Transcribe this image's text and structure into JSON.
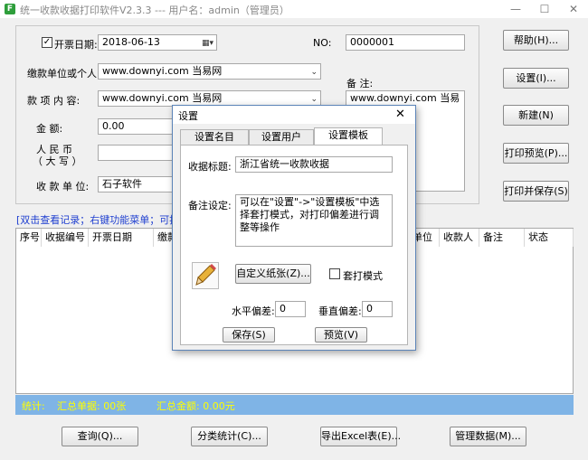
{
  "window": {
    "title": "统一收款收据打印软件V2.3.3 --- 用户名：admin（管理员）",
    "icon_letter": "F",
    "minimize": "—",
    "maximize": "☐",
    "close": "✕"
  },
  "form": {
    "invoice_date_checkbox": "✓",
    "invoice_date_label": "开票日期:",
    "invoice_date_value": "2018-06-13",
    "no_label": "NO:",
    "no_value": "0000001",
    "payer_label": "缴款单位或个人:",
    "payer_value": "www.downyi.com  当易网",
    "item_label": "款  项  内  容:",
    "item_value": "www.downyi.com  当易网",
    "amount_label": "金       额:",
    "amount_value": "0.00",
    "rmb_label_1": "人   民   币",
    "rmb_label_2": "（ 大  写 ）",
    "rmb_value": "",
    "receiver_label": "收  款  单  位:",
    "receiver_value": "石子软件",
    "remark_label": "备 注:",
    "remark_value": "www.downyi.com  当易"
  },
  "side_buttons": {
    "help": "帮助(H)...",
    "settings": "设置(I)...",
    "new": "新建(N)",
    "print_preview": "打印预览(P)...",
    "print_save": "打印并保存(S)"
  },
  "hint_text": "[双击查看记录；右键功能菜单；可按Ct",
  "table": {
    "columns": [
      "序号",
      "收据编号",
      "开票日期",
      "缴款",
      "单位",
      "收款人",
      "备注",
      "状态"
    ]
  },
  "stats": {
    "label": "统计:",
    "count_text": "汇总单据: 00张",
    "amount_text": "汇总金额: 0.00元"
  },
  "bottom_buttons": {
    "query": "查询(Q)...",
    "category_stats": "分类统计(C)...",
    "export_excel": "导出Excel表(E)...",
    "manage_data": "管理数据(M)..."
  },
  "dialog": {
    "title": "设置",
    "close": "✕",
    "tabs": [
      "设置名目",
      "设置用户",
      "设置模板"
    ],
    "receipt_title_label": "收据标题:",
    "receipt_title_value": "浙江省统一收款收据",
    "remark_setting_label": "备注设定:",
    "remark_setting_value": "可以在\"设置\"->\"设置模板\"中选择套打模式，对打印偏差进行调整等操作",
    "custom_paper_button": "自定义纸张(Z)...",
    "overprint_checkbox": "",
    "overprint_label": "套打模式",
    "h_offset_label": "水平偏差:",
    "h_offset_value": "0",
    "v_offset_label": "垂直偏差:",
    "v_offset_value": "0",
    "save_button": "保存(S)",
    "preview_button": "预览(V)"
  },
  "colors": {
    "stats_bar": "#7fb4e6",
    "stats_text": "#ffff00",
    "hint_text": "#1f3fd0",
    "dialog_border": "#5c84b8"
  }
}
